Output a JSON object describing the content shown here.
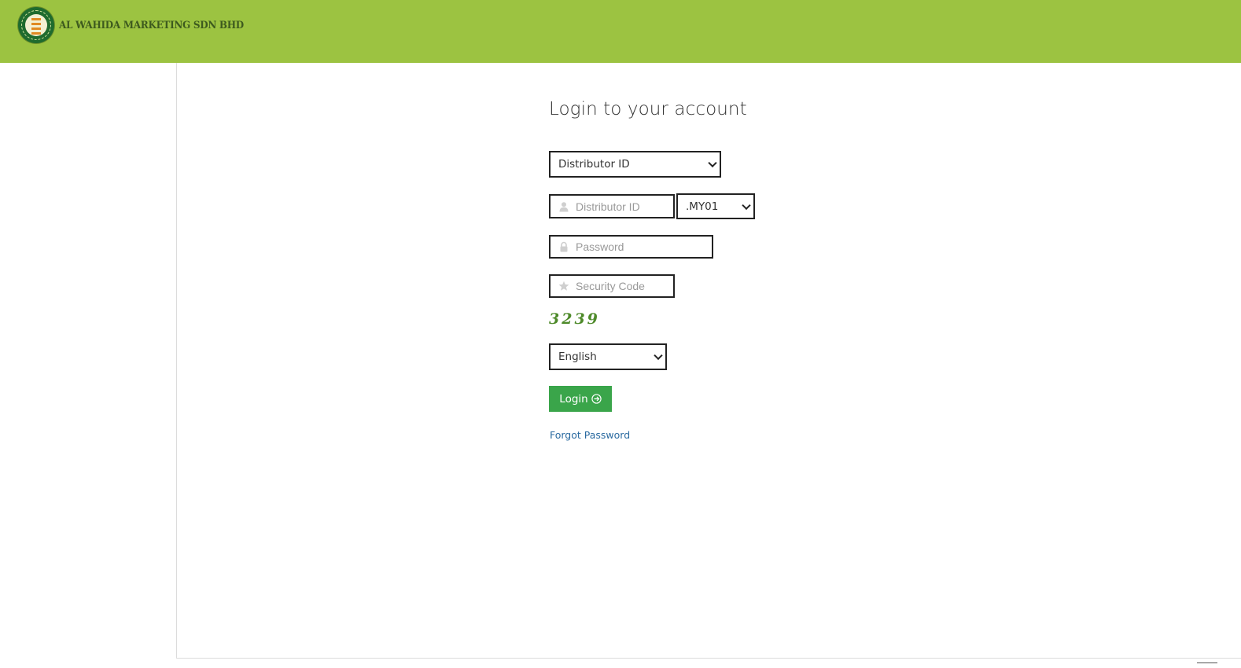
{
  "header": {
    "brand_name": "AL WAHIDA MARKETING SDN BHD",
    "logo_icon": "company-logo-icon",
    "background_color": "#9cc341"
  },
  "login": {
    "title": "Login to your account",
    "login_type_select": {
      "selected": "Distributor ID"
    },
    "distributor_id_input": {
      "placeholder": "Distributor ID",
      "value": "",
      "icon": "user-icon"
    },
    "region_select": {
      "selected": ".MY01"
    },
    "password_input": {
      "placeholder": "Password",
      "value": "",
      "icon": "lock-icon"
    },
    "security_code_input": {
      "placeholder": "Security Code",
      "value": "",
      "icon": "star-icon"
    },
    "captcha_text": "3239",
    "language_select": {
      "selected": "English"
    },
    "login_button_label": "Login",
    "login_button_icon": "arrow-circle-right-icon",
    "login_button_color": "#3aa54a",
    "forgot_password_label": "Forgot Password"
  }
}
